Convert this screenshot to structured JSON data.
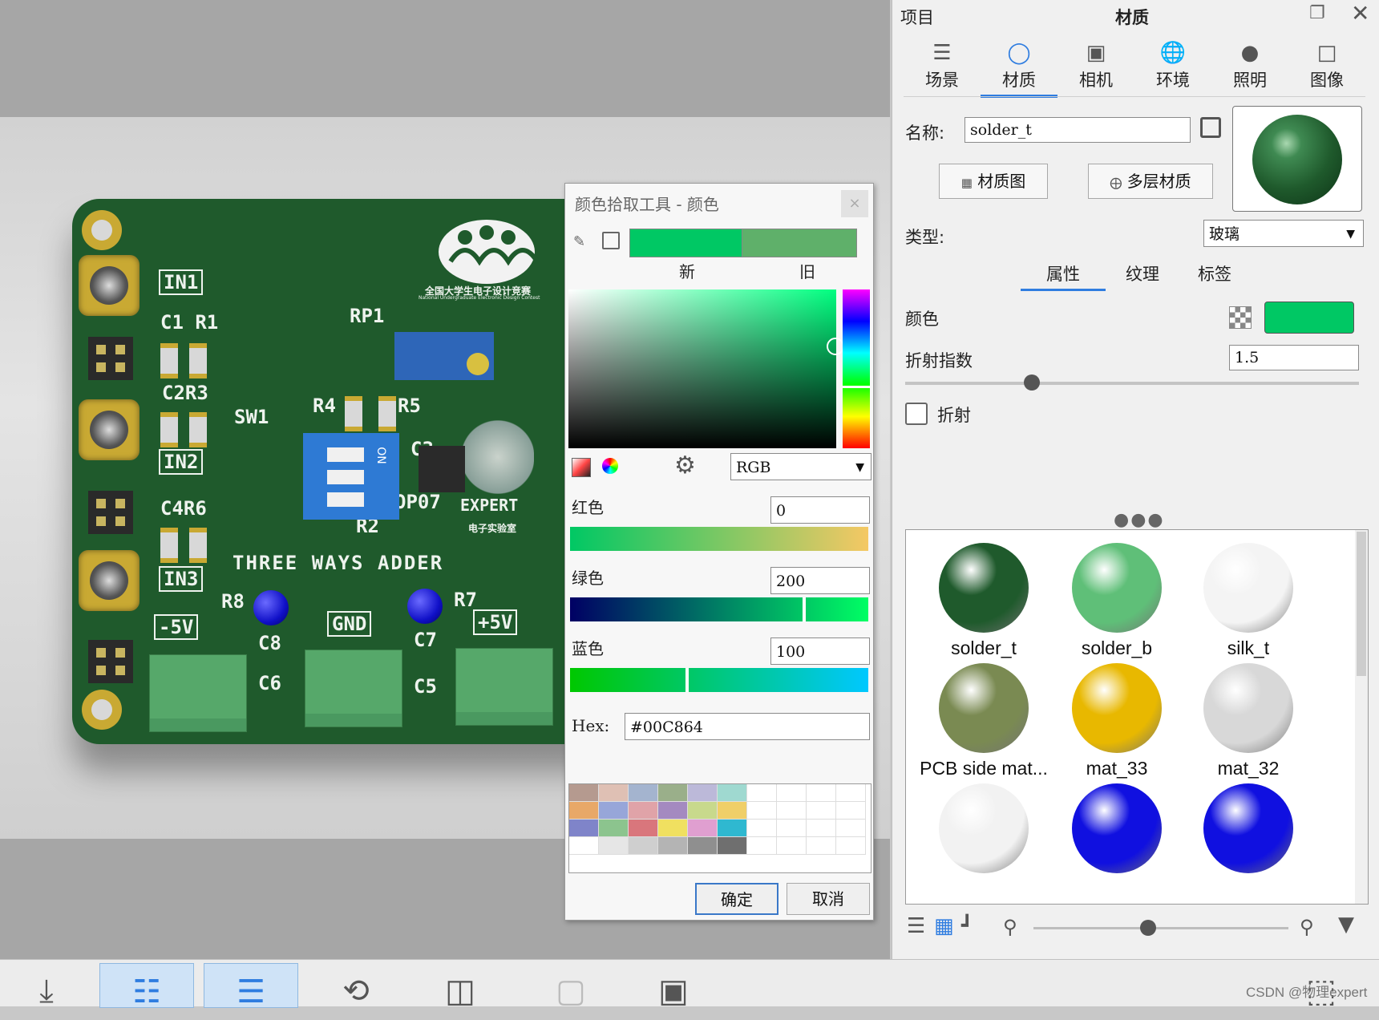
{
  "color_dialog": {
    "title": "颜色拾取工具 - 颜色",
    "close": "×",
    "new_label": "新",
    "old_label": "旧",
    "new_color": "#00C864",
    "old_color": "#5fb06a",
    "mode": "RGB",
    "red_label": "红色",
    "red_value": "0",
    "green_label": "绿色",
    "green_value": "200",
    "blue_label": "蓝色",
    "blue_value": "100",
    "hex_label": "Hex:",
    "hex_value": "#00C864",
    "ok": "确定",
    "cancel": "取消",
    "swatches": [
      "#b59a8f",
      "#dfc0b4",
      "#a4b4cf",
      "#9aaf8a",
      "#bcb9d9",
      "#9fd9d0",
      "",
      "",
      "",
      "",
      "#e8a868",
      "#97a6d9",
      "#e0a3a8",
      "#a48ac0",
      "#c8d98c",
      "#f0cf68",
      "",
      "",
      "",
      "",
      "#7f84c9",
      "#8cc48e",
      "#d9767c",
      "#f0e060",
      "#e09fd0",
      "#2fb8d0",
      "",
      "",
      "",
      "",
      "#ffffff",
      "#e6e6e6",
      "#cfcfcf",
      "#b4b4b4",
      "#8f8f8f",
      "#6f6f6f",
      "",
      "",
      "",
      ""
    ]
  },
  "viewport": {
    "board_labels": {
      "rp1": "RP1",
      "in1": "IN1",
      "c1r1": "C1 R1",
      "c2r3": "C2R3",
      "sw1": "SW1",
      "r4": "R4",
      "r5": "R5",
      "c3": "C3",
      "in2": "IN2",
      "c4r6": "C4R6",
      "op07": "OP07",
      "expert": "EXPERT",
      "lab": "电子实验室",
      "r2": "R2",
      "in3": "IN3",
      "tagline": "THREE WAYS ADDER",
      "r8": "R8",
      "r7": "R7",
      "m5v": "-5V",
      "gnd": "GND",
      "p5v": "+5V",
      "c8": "C8",
      "c7": "C7",
      "c6": "C6",
      "c5": "C5",
      "on": "ON",
      "logo_cn": "全国大学生电子设计竞赛",
      "logo_en": "National Undergraduate Electronic Design Contest"
    }
  },
  "panel": {
    "project_label": "项目",
    "title": "材质",
    "tabs": [
      {
        "label": "场景",
        "icon": "scene-icon"
      },
      {
        "label": "材质",
        "icon": "material-icon"
      },
      {
        "label": "相机",
        "icon": "camera-icon"
      },
      {
        "label": "环境",
        "icon": "environment-icon"
      },
      {
        "label": "照明",
        "icon": "lighting-icon"
      },
      {
        "label": "图像",
        "icon": "image-icon"
      }
    ],
    "name_label": "名称:",
    "name_value": "solder_t",
    "material_graph_btn": "材质图",
    "multilayer_btn": "多层材质",
    "type_label": "类型:",
    "type_value": "玻璃",
    "subtabs": [
      "属性",
      "纹理",
      "标签"
    ],
    "color_label": "颜色",
    "color_value": "#00C864",
    "ior_label": "折射指数",
    "ior_value": "1.5",
    "ior_level": 0.28,
    "refraction_label": "折射",
    "zoom_level": 0.45,
    "library": [
      {
        "name": "solder_t",
        "color": "#1f5a2c"
      },
      {
        "name": "solder_b",
        "color": "#5fbf78"
      },
      {
        "name": "silk_t",
        "color": "#f4f4f4"
      },
      {
        "name": "PCB side mat...",
        "color": "#7a8a52"
      },
      {
        "name": "mat_33",
        "color": "#e8b800"
      },
      {
        "name": "mat_32",
        "color": "#d8d8d8"
      },
      {
        "name": "",
        "color": "#f2f2f2"
      },
      {
        "name": "",
        "color": "#1010e0"
      },
      {
        "name": "",
        "color": "#1010e0"
      }
    ]
  },
  "watermark": "CSDN @物理expert"
}
